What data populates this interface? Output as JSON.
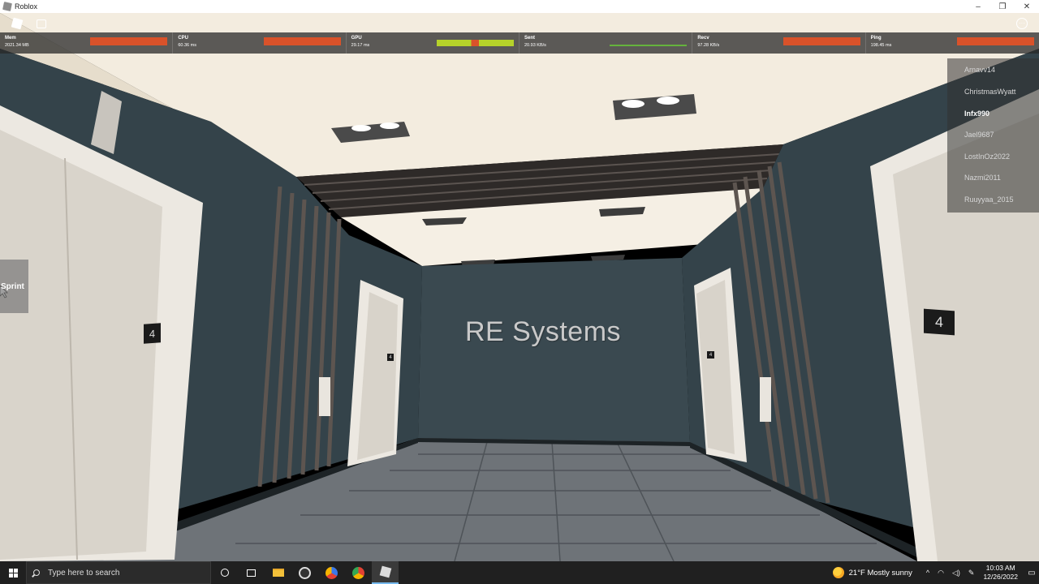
{
  "window": {
    "title": "Roblox",
    "controls": [
      "–",
      "❐",
      "✕"
    ]
  },
  "perf_stats": [
    {
      "label": "Mem",
      "value": "2021.34 MB"
    },
    {
      "label": "CPU",
      "value": "60.36 ms"
    },
    {
      "label": "GPU",
      "value": "29.17 ms"
    },
    {
      "label": "Sent",
      "value": "20.93 KB/s"
    },
    {
      "label": "Recv",
      "value": "97.28 KB/s"
    },
    {
      "label": "Ping",
      "value": "198.45 ms"
    }
  ],
  "players": [
    "Arnavv14",
    "ChristmasWyatt",
    "Infx990",
    "Jael9687",
    "LostInOz2022",
    "Nazmi2011",
    "Ruuyyaa_2015"
  ],
  "current_player": "Infx990",
  "sprint_label": "Sprint",
  "scene": {
    "wall_sign": "RE Systems",
    "floor_number": "4"
  },
  "taskbar": {
    "search_placeholder": "Type here to search",
    "weather": "21°F  Mostly sunny",
    "time": "10:03 AM",
    "date": "12/26/2022",
    "tray_icons": [
      "chevron-up-icon",
      "network-icon",
      "volume-icon",
      "pen-icon"
    ],
    "pinned": [
      "cortana-icon",
      "task-view-icon",
      "file-explorer-icon",
      "obs-icon",
      "chrome-icon",
      "chrome-icon",
      "roblox-icon"
    ]
  },
  "colors": {
    "stat_bar": "#d9522a",
    "wall": "#36454c",
    "ceiling": "#f5efe4"
  }
}
